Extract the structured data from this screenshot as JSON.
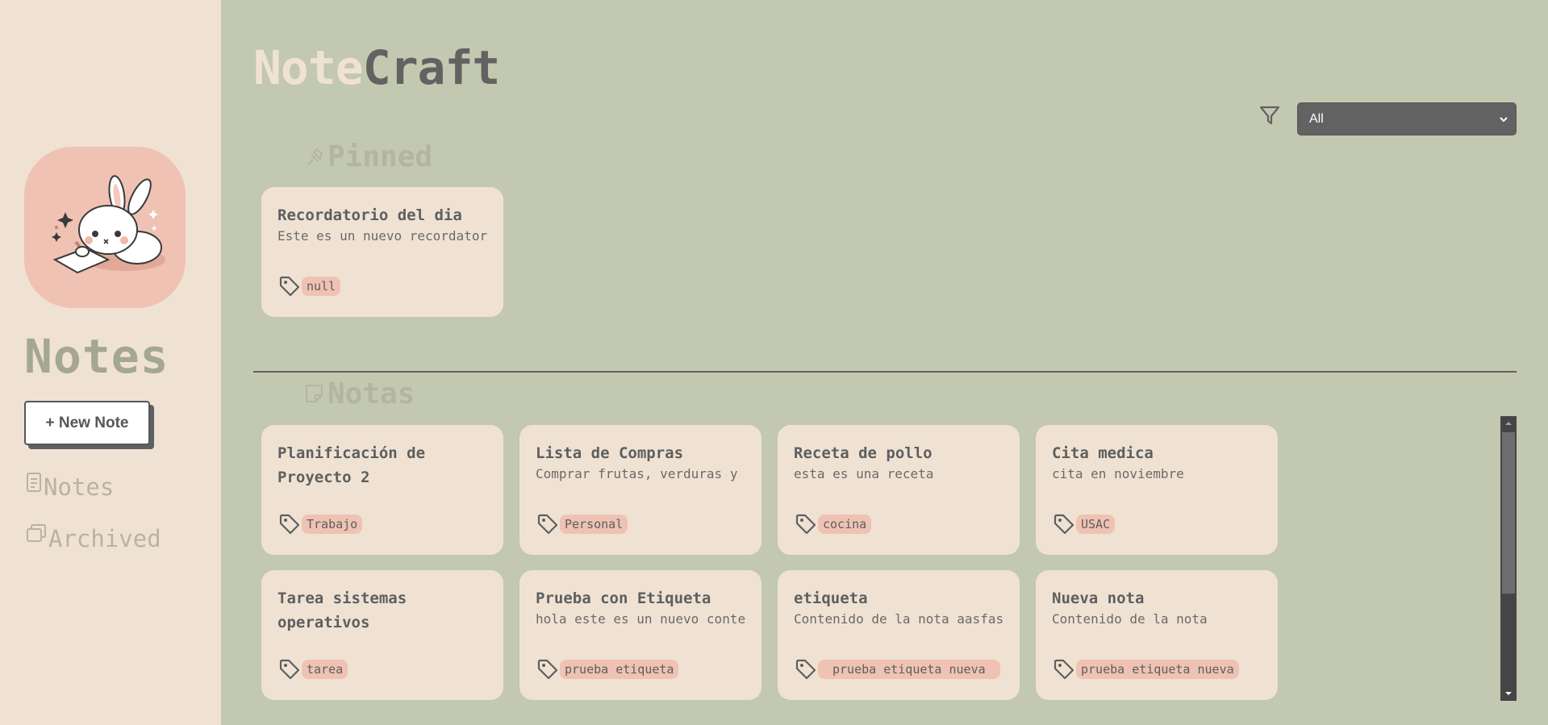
{
  "sidebar": {
    "title": "Notes",
    "new_note_label": "+ New Note",
    "nav": [
      {
        "label": "Notes",
        "icon": "document-icon"
      },
      {
        "label": "Archived",
        "icon": "archive-icon"
      }
    ]
  },
  "header": {
    "brand_part1": "Note",
    "brand_part2": "Craft",
    "filter_value": "All"
  },
  "sections": {
    "pinned": "Pinned",
    "notas": "Notas"
  },
  "pinned_notes": [
    {
      "title": "Recordatorio del dia",
      "content": "Este es un nuevo recordatorio",
      "tag": "null"
    }
  ],
  "notes": [
    {
      "title": "Planificación de Proyecto 2",
      "content": "",
      "tag": "Trabajo"
    },
    {
      "title": "Lista de Compras",
      "content": "Comprar frutas, verduras y",
      "tag": "Personal"
    },
    {
      "title": "Receta de pollo",
      "content": "esta es una receta",
      "tag": "cocina"
    },
    {
      "title": "Cita medica",
      "content": "cita en noviembre",
      "tag": "USAC"
    },
    {
      "title": "Tarea sistemas operativos",
      "content": "",
      "tag": "tarea"
    },
    {
      "title": "Prueba con Etiqueta",
      "content": "hola este es un nuevo contenido",
      "tag": "prueba etiqueta"
    },
    {
      "title": "etiqueta",
      "content": "Contenido de la nota aasfasf",
      "tag": "prueba etiqueta nueva"
    },
    {
      "title": "Nueva nota",
      "content": "Contenido de la nota",
      "tag": "prueba etiqueta nueva"
    }
  ],
  "colors": {
    "sidebar_bg": "#f0e2d3",
    "main_bg": "#c3c8b0",
    "card_bg": "#f0e2d3",
    "tag_bg": "#efc2b3",
    "accent_dark": "#626262"
  }
}
